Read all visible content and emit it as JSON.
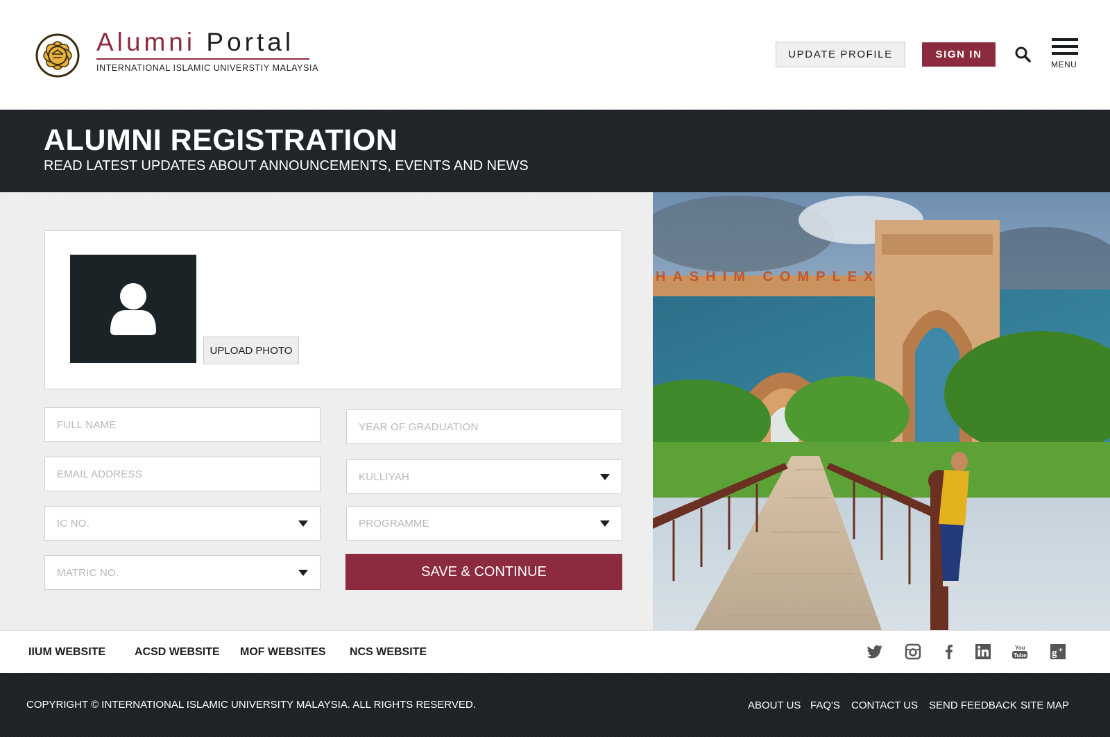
{
  "header": {
    "brand_word1": "Alumni",
    "brand_word2": "Portal",
    "brand_subtitle": "INTERNATIONAL ISLAMIC UNIVERSTIY MALAYSIA",
    "update_profile_label": "UPDATE PROFILE",
    "sign_in_label": "SIGN IN",
    "menu_label": "MENU",
    "icons": [
      "logo-emblem",
      "search-icon",
      "hamburger-menu-icon"
    ]
  },
  "banner": {
    "title": "ALUMNI REGISTRATION",
    "subtitle": "READ LATEST UPDATES ABOUT ANNOUNCEMENTS, EVENTS AND NEWS"
  },
  "form": {
    "upload_photo_label": "UPLOAD PHOTO",
    "full_name_placeholder": "FULL NAME",
    "email_placeholder": "EMAIL ADDRESS",
    "ic_placeholder": "IC NO.",
    "matric_placeholder": "MATRIC NO.",
    "year_placeholder": "YEAR OF GRADUATION",
    "kulliyah_placeholder": "KULLIYAH",
    "programme_placeholder": "PROGRAMME",
    "save_label": "SAVE & CONTINUE"
  },
  "photo": {
    "sign_text": "HASHIM COMPLEX"
  },
  "links": {
    "items": [
      "IIUM WEBSITE",
      "ACSD WEBSITE",
      "MOF WEBSITES",
      "NCS WEBSITE"
    ],
    "social_icons": [
      "twitter-icon",
      "instagram-icon",
      "facebook-icon",
      "linkedin-icon",
      "youtube-icon",
      "google-plus-icon"
    ]
  },
  "footer": {
    "copyright": "COPYRIGHT © INTERNATIONAL ISLAMIC UNIVERSITY MALAYSIA. ALL RIGHTS RESERVED.",
    "nav": [
      "ABOUT US",
      "FAQ'S",
      "CONTACT US",
      "SEND FEEDBACK",
      "SITE MAP"
    ]
  },
  "colors": {
    "accent": "#8c2a3e",
    "dark": "#1d2326",
    "form_bg": "#eeeeee"
  }
}
